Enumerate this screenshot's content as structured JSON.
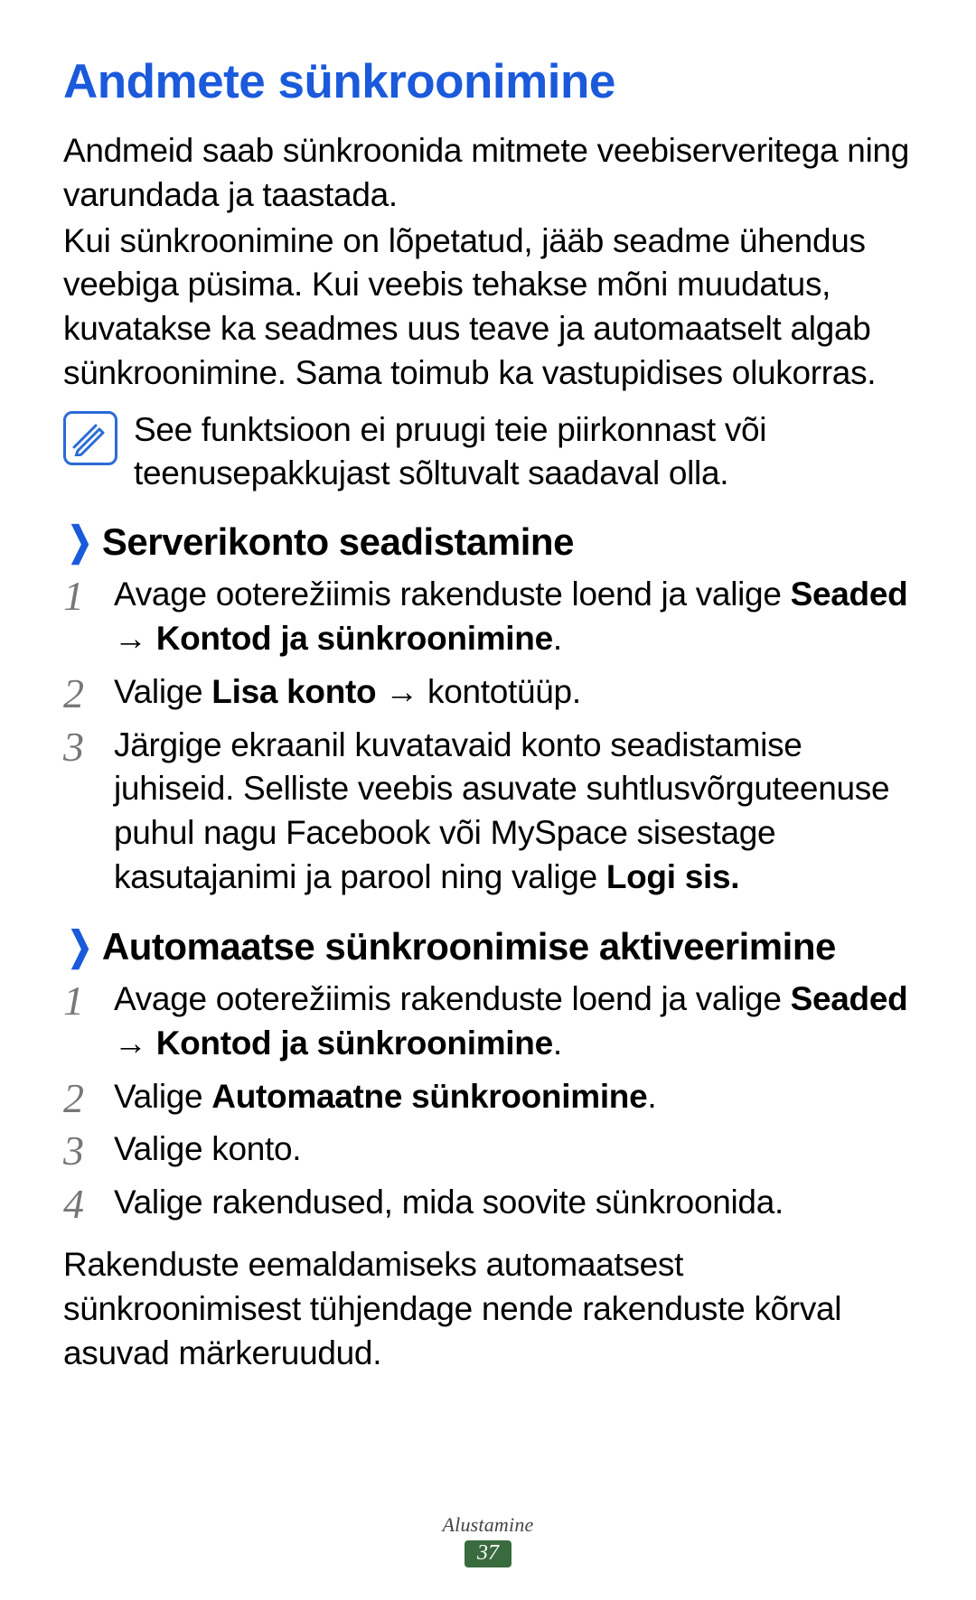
{
  "title": "Andmete sünkroonimine",
  "intro1": "Andmeid saab sünkroonida mitmete veebiserveritega ning varundada ja taastada.",
  "intro2": "Kui sünkroonimine on lõpetatud, jääb seadme ühendus veebiga püsima. Kui veebis tehakse mõni muudatus, kuvatakse ka seadmes uus teave ja automaatselt algab sünkroonimine. Sama toimub ka vastupidises olukorras.",
  "note": "See funktsioon ei pruugi teie piirkonnast või teenusepakkujast sõltuvalt saadaval olla.",
  "sec1": {
    "heading": "Serverikonto seadistamine",
    "step1_a": "Avage ooterežiimis rakenduste loend ja valige ",
    "step1_b": "Seaded",
    "step1_arrow": " → ",
    "step1_c": "Kontod ja sünkroonimine",
    "step1_d": ".",
    "step2_a": "Valige ",
    "step2_b": "Lisa konto",
    "step2_arrow": " → ",
    "step2_c": "kontotüüp.",
    "step3_a": "Järgige ekraanil kuvatavaid konto seadistamise juhiseid. Selliste veebis asuvate suhtlusvõrguteenuse puhul nagu Facebook või MySpace sisestage kasutajanimi ja parool ning valige ",
    "step3_b": "Logi sis."
  },
  "sec2": {
    "heading": "Automaatse sünkroonimise aktiveerimine",
    "step1_a": "Avage ooterežiimis rakenduste loend ja valige ",
    "step1_b": "Seaded",
    "step1_arrow": " → ",
    "step1_c": "Kontod ja sünkroonimine",
    "step1_d": ".",
    "step2_a": "Valige ",
    "step2_b": "Automaatne sünkroonimine",
    "step2_c": ".",
    "step3": "Valige konto.",
    "step4": "Valige rakendused, mida soovite sünkroonida."
  },
  "outro": "Rakenduste eemaldamiseks automaatsest sünkroonimisest tühjendage nende rakenduste kõrval asuvad märkeruudud.",
  "footer": {
    "section": "Alustamine",
    "page": "37"
  }
}
